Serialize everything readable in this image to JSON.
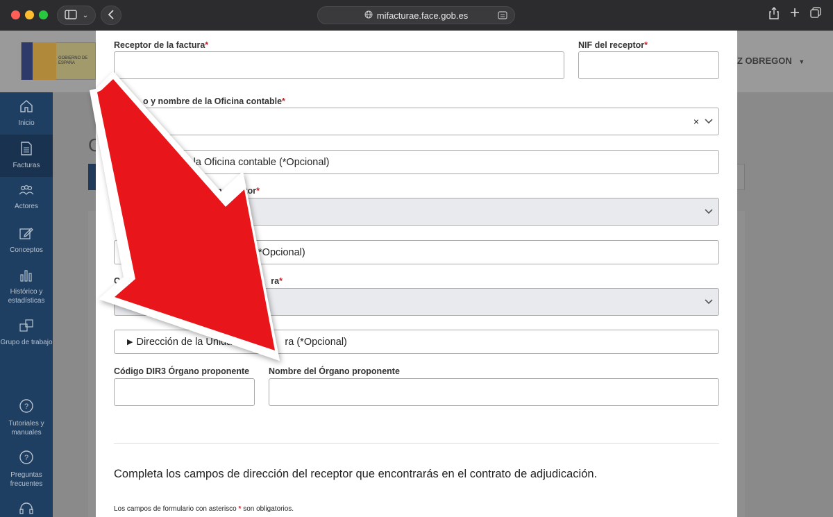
{
  "browser": {
    "url": "mifacturae.face.gob.es"
  },
  "header": {
    "gov_logo_text": "GOBIERNO DE ESPAÑA",
    "user_name_partial": "Z OBREGON"
  },
  "nav": {
    "items": [
      {
        "label": "Inicio",
        "icon": "home-icon"
      },
      {
        "label": "Facturas",
        "icon": "document-icon"
      },
      {
        "label": "Actores",
        "icon": "people-icon"
      },
      {
        "label": "Conceptos",
        "icon": "edit-icon"
      },
      {
        "label": "Histórico y estadísticas",
        "icon": "bar-chart-icon"
      },
      {
        "label": "Grupo de trabajo",
        "icon": "group-icon"
      },
      {
        "label": "Tutoriales y manuales",
        "icon": "help-icon"
      },
      {
        "label": "Preguntas frecuentes",
        "icon": "help-icon"
      }
    ],
    "active": "Facturas"
  },
  "form": {
    "receptor_label": "Receptor de la factura",
    "nif_label": "NIF del receptor",
    "oficina_label": "o y nombre de la Oficina contable",
    "oficina_dir": "de la Oficina contable (*Opcional)",
    "organo_label_a": "Código y",
    "organo_label_b": "Órgano gestor",
    "organo_dir_a": "Dirección d",
    "organo_dir_b": "stor (*Opcional)",
    "unidad_label_a": "Código y nombre de la",
    "unidad_label_b": "ra",
    "unidad_dir_a": "Dirección de la Unidad t",
    "unidad_dir_b": "ra (*Opcional)",
    "dir3_label": "Código DIR3 Órgano proponente",
    "nombre_organo_label": "Nombre del Órgano proponente",
    "required_mark": "*",
    "help_text": "Completa los campos de dirección del receptor que encontrarás en el contrato de adjudicación.",
    "note_text_a": "Los campos de formulario con asterisco",
    "note_text_b": "son obligatorios."
  },
  "colors": {
    "required": "#c1272d",
    "nav_bg": "#1f3f62",
    "arrow": "#e8161b"
  }
}
